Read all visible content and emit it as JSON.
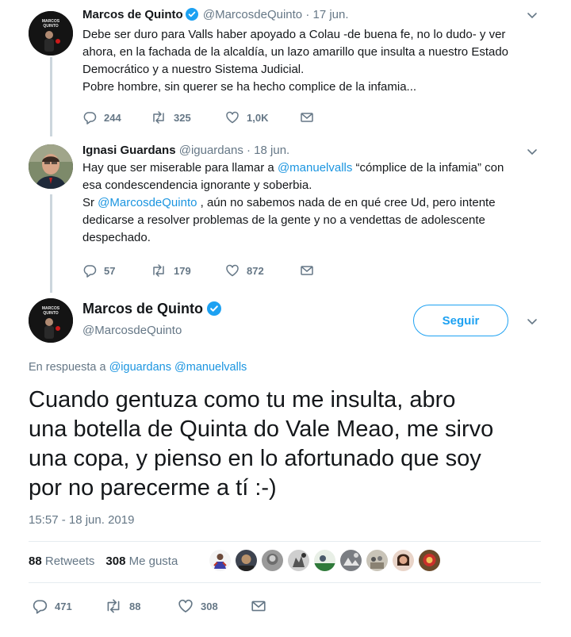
{
  "tweet1": {
    "name": "Marcos de Quinto",
    "handle": "@MarcosdeQuinto",
    "date": "· 17 jun.",
    "lines": [
      "Debe ser duro para Valls haber apoyado a Colau -de buena fe, no lo dudo- y ver",
      "ahora, en la fachada de la alcaldía, un lazo amarillo que insulta a nuestro Estado",
      "Democrático y a nuestro Sistema Judicial.",
      "Pobre hombre, sin querer se ha hecho complice de la infamia..."
    ],
    "replies": "244",
    "retweets": "325",
    "likes": "1,0K"
  },
  "tweet2": {
    "name": "Ignasi Guardans",
    "handle": "@iguardans",
    "date": "· 18 jun.",
    "line1": "Hay que ser miserable para llamar a ",
    "mention1": "@manuelvalls",
    "line1_end": " “cómplice de la infamia” con",
    "line2": "esa condescendencia ignorante y soberbia.",
    "line3_start": "Sr ",
    "mention2": "@MarcosdeQuinto",
    "line3_end": " , aún no sabemos nada de en qué cree Ud, pero intente",
    "line4": "dedicarse a resolver problemas de la gente y no a vendettas de adolescente",
    "line5": "despechado.",
    "replies": "57",
    "retweets": "179",
    "likes": "872"
  },
  "main": {
    "name": "Marcos de Quinto",
    "handle": "@MarcosdeQuinto",
    "follow_label": "Seguir",
    "reply_prefix": "En respuesta a",
    "reply_mention1": "@iguardans",
    "reply_mention2": "@manuelvalls",
    "text": "Cuando gentuza como tu me insulta, abro\nuna botella de Quinta do Vale Meao, me sirvo\nuna copa, y pienso en lo afortunado que soy\npor no parecerme a tí :-)",
    "timestamp": "15:57 - 18 jun. 2019",
    "retweets_count": "88",
    "retweets_label": "Retweets",
    "likes_count": "308",
    "likes_label": "Me gusta",
    "replies": "471",
    "retweets": "88",
    "likes": "308"
  },
  "colors": {
    "link": "#1b95e0",
    "verified": "#1da1f2",
    "muted": "#657786"
  }
}
